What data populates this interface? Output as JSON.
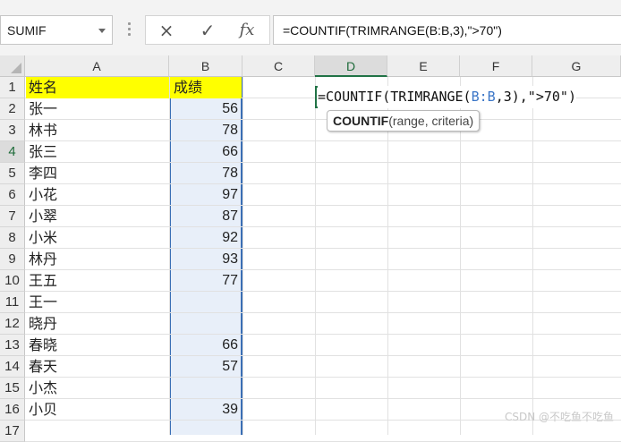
{
  "name_box": {
    "value": "SUMIF"
  },
  "formula_bar": {
    "cancel_icon": "×",
    "enter_icon": "✓",
    "function_icon": "fx",
    "formula": "=COUNTIF(TRIMRANGE(B:B,3),\">70\")"
  },
  "columns": [
    "A",
    "B",
    "C",
    "D",
    "E",
    "F",
    "G"
  ],
  "active_column": "D",
  "active_row": "4",
  "rows": [
    {
      "num": "1",
      "a": "姓名",
      "b": "成绩"
    },
    {
      "num": "2",
      "a": "张一",
      "b": "56"
    },
    {
      "num": "3",
      "a": "林书",
      "b": "78"
    },
    {
      "num": "4",
      "a": "张三",
      "b": "66"
    },
    {
      "num": "5",
      "a": "李四",
      "b": "78"
    },
    {
      "num": "6",
      "a": "小花",
      "b": "97"
    },
    {
      "num": "7",
      "a": "小翠",
      "b": "87"
    },
    {
      "num": "8",
      "a": "小米",
      "b": "92"
    },
    {
      "num": "9",
      "a": "林丹",
      "b": "93"
    },
    {
      "num": "10",
      "a": "王五",
      "b": "77"
    },
    {
      "num": "11",
      "a": "王一",
      "b": ""
    },
    {
      "num": "12",
      "a": "晓丹",
      "b": ""
    },
    {
      "num": "13",
      "a": "春晓",
      "b": "66"
    },
    {
      "num": "14",
      "a": "春天",
      "b": "57"
    },
    {
      "num": "15",
      "a": "小杰",
      "b": ""
    },
    {
      "num": "16",
      "a": "小贝",
      "b": "39"
    },
    {
      "num": "17",
      "a": "",
      "b": ""
    }
  ],
  "cell_edit": {
    "prefix": "=COUNTIF(TRIMRANGE(",
    "ref": "B:B",
    "suffix": ",3),\">70\")"
  },
  "tooltip": {
    "function": "COUNTIF",
    "args": "(range, criteria)"
  },
  "watermark": "CSDN @不吃鱼不吃鱼",
  "colors": {
    "header_fill": "#ffff00",
    "selection": "#e8eff9",
    "active_border": "#217346",
    "ref_color": "#3b76c7"
  }
}
